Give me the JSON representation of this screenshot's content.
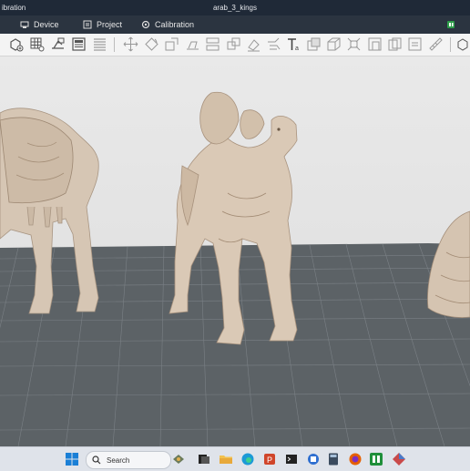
{
  "window": {
    "title_left": "ibration",
    "title": "arab_3_kings"
  },
  "menu": {
    "items": [
      {
        "label": "Device",
        "icon": "device-icon"
      },
      {
        "label": "Project",
        "icon": "project-icon"
      },
      {
        "label": "Calibration",
        "icon": "calibration-icon"
      }
    ],
    "right_icon": "app-status-icon"
  },
  "toolbar": {
    "icons": [
      "add-object-icon",
      "grid-arrange-icon",
      "import-icon",
      "plate-icon",
      "slice-list-icon",
      "move-icon",
      "rotate-icon",
      "scale-icon",
      "lay-on-face-icon",
      "cut-icon",
      "split-icon",
      "support-paint-icon",
      "seam-paint-icon",
      "text-icon",
      "cube-icon",
      "box-icon",
      "frame-icon",
      "measure-icon",
      "copy-icon",
      "layers-icon",
      "ruler-icon",
      "more-icon"
    ]
  },
  "viewport": {
    "scene": "three camel 3D models on build plate",
    "bed_color": "#5c6266",
    "grid_color": "#7b8186",
    "model_color": "#d8c8b7"
  },
  "taskbar": {
    "search_placeholder": "Search",
    "icons": [
      "windows-start-icon",
      "search-icon",
      "ai-game-icon",
      "task-view-icon",
      "file-explorer-icon",
      "edge-browser-icon",
      "powerpoint-icon",
      "terminal-icon",
      "store-app-icon",
      "calculator-icon",
      "firefox-icon",
      "slicer-app-icon",
      "3d-app-icon"
    ]
  }
}
